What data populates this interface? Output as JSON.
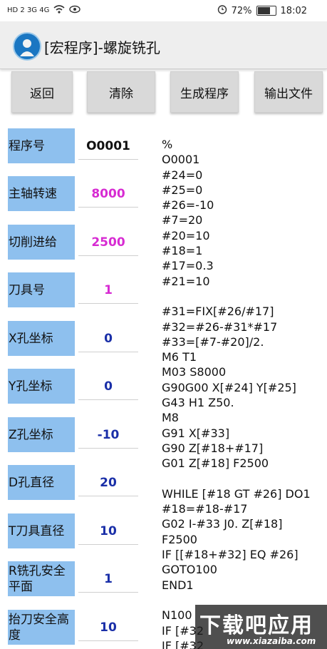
{
  "status_bar": {
    "signal_left": "HD 2  3G  4G",
    "battery_percent": "72%",
    "battery_level": 0.72,
    "time": "18:02"
  },
  "app_bar": {
    "title": "[宏程序]-螺旋铣孔"
  },
  "buttons": {
    "back": "返回",
    "clear": "清除",
    "generate": "生成程序",
    "export": "输出文件"
  },
  "params": [
    {
      "label": "程序号",
      "value": "O0001",
      "color": "#111111"
    },
    {
      "label": "主轴转速",
      "value": "8000",
      "color": "#d72bd2"
    },
    {
      "label": "切削进给",
      "value": "2500",
      "color": "#d72bd2"
    },
    {
      "label": "刀具号",
      "value": "1",
      "color": "#d72bd2"
    },
    {
      "label": "X孔坐标",
      "value": "0",
      "color": "#1a2fa8"
    },
    {
      "label": "Y孔坐标",
      "value": "0",
      "color": "#1a2fa8"
    },
    {
      "label": "Z孔坐标",
      "value": "-10",
      "color": "#1a2fa8"
    },
    {
      "label": "D孔直径",
      "value": "20",
      "color": "#1a2fa8"
    },
    {
      "label": "T刀具直径",
      "value": "10",
      "color": "#1a2fa8"
    },
    {
      "label": "R铣孔安全平面",
      "value": "1",
      "color": "#1a2fa8"
    },
    {
      "label": "抬刀安全高度",
      "value": "10",
      "color": "#1a2fa8"
    }
  ],
  "program_text": "%\nO0001\n#24=0\n#25=0\n#26=-10\n#7=20\n#20=10\n#18=1\n#17=0.3\n#21=10\n\n#31=FIX[#26/#17]\n#32=#26-#31*#17\n#33=[#7-#20]/2.\nM6 T1\nM03 S8000\nG90G00 X[#24] Y[#25]\nG43 H1 Z50.\nM8\nG91 X[#33]\nG90 Z[#18+#17]\nG01 Z[#18] F2500\n\nWHILE [#18 GT #26] DO1\n#18=#18-#17\nG02 I-#33 J0. Z[#18]\nF2500\nIF [[#18+#32] EQ #26]\nGOTO100\nEND1\n\nN100\nIF [#32\nIF [#32",
  "watermark": {
    "main": "下载吧应用",
    "sub": "www.xiazaiba.com"
  }
}
